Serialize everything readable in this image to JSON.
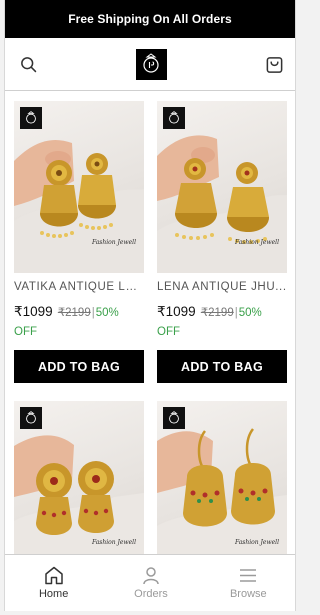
{
  "announcement": {
    "text": "Free Shipping On All Orders"
  },
  "header": {
    "search_icon": "search-icon",
    "cart_icon": "shopping-bag-icon",
    "logo_icon": "brand-logo"
  },
  "products": [
    {
      "name": "VATIKA ANTIQUE LA...",
      "price": "₹1099",
      "mrp": "₹2199",
      "discount": "50%",
      "discount_suffix": "OFF",
      "add_label": "ADD TO BAG",
      "watermark": "Fashion Jewell"
    },
    {
      "name": "LENA ANTIQUE JHU...",
      "price": "₹1099",
      "mrp": "₹2199",
      "discount": "50%",
      "discount_suffix": "OFF",
      "add_label": "ADD TO BAG",
      "watermark": "Fashion Jewell"
    },
    {
      "watermark": "Fashion Jewell"
    },
    {
      "watermark": "Fashion Jewell"
    }
  ],
  "nav": {
    "items": [
      {
        "label": "Home",
        "icon": "home-icon"
      },
      {
        "label": "Orders",
        "icon": "user-icon"
      },
      {
        "label": "Browse",
        "icon": "menu-icon"
      }
    ]
  }
}
